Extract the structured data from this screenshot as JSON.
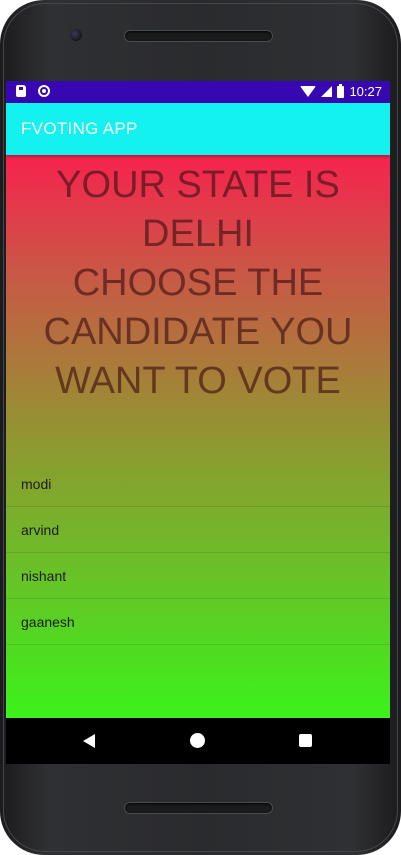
{
  "status_bar": {
    "time": "10:27",
    "left_icons": [
      "sd-card-icon",
      "circle-notification-icon"
    ],
    "right_icons": [
      "wifi-icon",
      "signal-icon",
      "battery-icon"
    ]
  },
  "app_bar": {
    "title": "FVOTING APP",
    "color": "#13f2f0"
  },
  "headline": {
    "lines": [
      "YOUR STATE IS",
      "DELHI",
      "CHOOSE THE",
      "CANDIDATE YOU",
      "WANT TO VOTE"
    ]
  },
  "candidates": [
    {
      "label": "modi"
    },
    {
      "label": "arvind"
    },
    {
      "label": "nishant"
    },
    {
      "label": "gaanesh"
    }
  ],
  "nav_bar": {
    "icons": [
      "back-icon",
      "home-icon",
      "recents-icon"
    ]
  },
  "colors": {
    "status_bar": "#3707b2",
    "gradient_top": "#f7224f",
    "gradient_bottom": "#3bf21a"
  }
}
